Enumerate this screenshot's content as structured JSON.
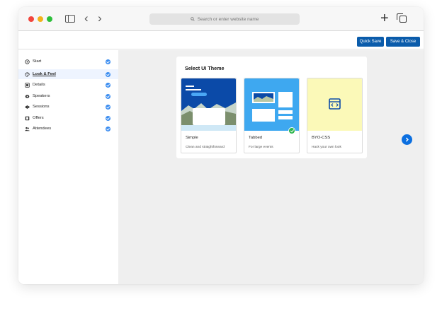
{
  "browser": {
    "address_placeholder": "Search or enter website name"
  },
  "header": {
    "quick_save_label": "Quick Save",
    "save_close_label": "Save & Close"
  },
  "sidebar": {
    "items": [
      {
        "label": "Start",
        "icon": "start-icon",
        "completed": true
      },
      {
        "label": "Look & Feel",
        "icon": "palette-icon",
        "completed": true,
        "active": true
      },
      {
        "label": "Details",
        "icon": "details-icon",
        "completed": true
      },
      {
        "label": "Speakers",
        "icon": "speakers-icon",
        "completed": true
      },
      {
        "label": "Sessions",
        "icon": "sessions-icon",
        "completed": true
      },
      {
        "label": "Offers",
        "icon": "offers-icon",
        "completed": true
      },
      {
        "label": "Attendees",
        "icon": "attendees-icon",
        "completed": true
      }
    ]
  },
  "theme_picker": {
    "title": "Select UI Theme",
    "themes": [
      {
        "name": "Simple",
        "description": "Clean and straightforward",
        "selected": false
      },
      {
        "name": "Tabbed",
        "description": "For large events",
        "selected": true
      },
      {
        "name": "BYO-CSS",
        "description": "Hack your own look",
        "selected": false
      }
    ]
  },
  "colors": {
    "brand_blue": "#0b5cab",
    "check_blue": "#3a8cf0",
    "selected_green": "#2bb44a",
    "simple_preview_bg": "#0b4aa8",
    "tabbed_preview_bg": "#3ea8f0",
    "byo_preview_bg": "#fbf9b8"
  }
}
